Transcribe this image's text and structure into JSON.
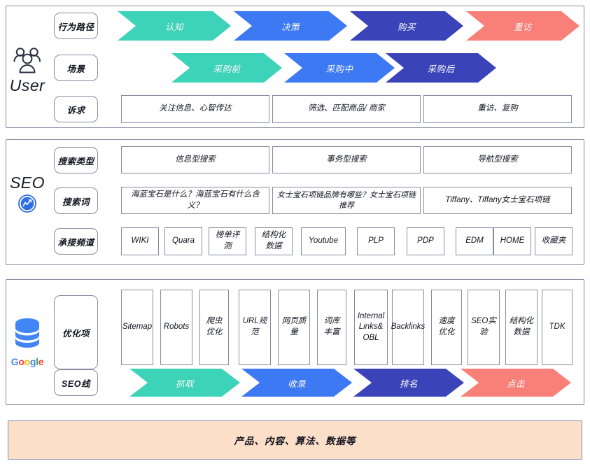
{
  "colors": {
    "teal": "#3DD3B8",
    "blue": "#3D79F2",
    "indigo": "#3A44B8",
    "salmon": "#F98079",
    "panel_border": "#8a8ba3",
    "foundation_bg": "#fbdfc8",
    "google_blue": "#4285F4",
    "google_red": "#EA4335",
    "google_yellow": "#FBBC05",
    "google_green": "#34A853",
    "text": "#12131f"
  },
  "sections": {
    "user": {
      "brand_label": "User",
      "icon": "people-icon",
      "rows": [
        {
          "chip": "行为路径",
          "type": "chevrons",
          "items": [
            {
              "label": "认知",
              "color": "#3DD3B8"
            },
            {
              "label": "决策",
              "color": "#3D79F2"
            },
            {
              "label": "购买",
              "color": "#3A44B8"
            },
            {
              "label": "重访",
              "color": "#F98079"
            }
          ]
        },
        {
          "chip": "场景",
          "type": "chevrons",
          "items": [
            {
              "label": "采购前",
              "color": "#3DD3B8"
            },
            {
              "label": "采购中",
              "color": "#3D79F2"
            },
            {
              "label": "采购后",
              "color": "#3A44B8"
            }
          ]
        },
        {
          "chip": "诉求",
          "type": "cells",
          "items": [
            {
              "label": "关注信息、心智传达"
            },
            {
              "label": "筛选、匹配商品/ 商家"
            },
            {
              "label": "重访、复购"
            }
          ]
        }
      ]
    },
    "seo": {
      "brand_label": "SEO",
      "icon": "seo-chart-circle-icon",
      "rows": [
        {
          "chip": "搜索类型",
          "type": "cells",
          "items": [
            {
              "label": "信息型搜索"
            },
            {
              "label": "事务型搜索"
            },
            {
              "label": "导航型搜索"
            }
          ]
        },
        {
          "chip": "搜索词",
          "type": "cells",
          "items": [
            {
              "label": "海蓝宝石是什么？海蓝宝石有什么含义？"
            },
            {
              "label": "女士宝石项链品牌有哪些？女士宝石项链推荐"
            },
            {
              "label": "Tiffany、Tiffany女士宝石项链"
            }
          ]
        },
        {
          "chip": "承接频道",
          "type": "channels",
          "items": [
            {
              "label": "WIKI"
            },
            {
              "label": "Quara"
            },
            {
              "label": "榜单评测"
            },
            {
              "label": "结构化数据"
            },
            {
              "label": "Youtube"
            },
            {
              "label": "PLP"
            },
            {
              "label": "PDP"
            },
            {
              "label": "EDM"
            },
            {
              "label": "HOME"
            },
            {
              "label": "收藏夹"
            }
          ]
        }
      ]
    },
    "google": {
      "brand_label": "Google",
      "icon": "database-icon",
      "rows": [
        {
          "chip": "优化项",
          "type": "optim",
          "items": [
            {
              "label": "Sitemap"
            },
            {
              "label": "Robots"
            },
            {
              "label": "爬虫优化"
            },
            {
              "label": "URL规范"
            },
            {
              "label": "网页质量"
            },
            {
              "label": "词库丰富"
            },
            {
              "label": "Internal Links& OBL"
            },
            {
              "label": "Backlinks"
            },
            {
              "label": "速度优化"
            },
            {
              "label": "SEO实验"
            },
            {
              "label": "结构化数据"
            },
            {
              "label": "TDK"
            }
          ]
        },
        {
          "chip": "SEO线",
          "type": "chevrons",
          "items": [
            {
              "label": "抓取",
              "color": "#3DD3B8"
            },
            {
              "label": "收录",
              "color": "#3D79F2"
            },
            {
              "label": "排名",
              "color": "#3A44B8"
            },
            {
              "label": "点击",
              "color": "#F98079"
            }
          ]
        }
      ]
    },
    "foundation": {
      "label": "产品、内容、算法、数据等"
    }
  }
}
